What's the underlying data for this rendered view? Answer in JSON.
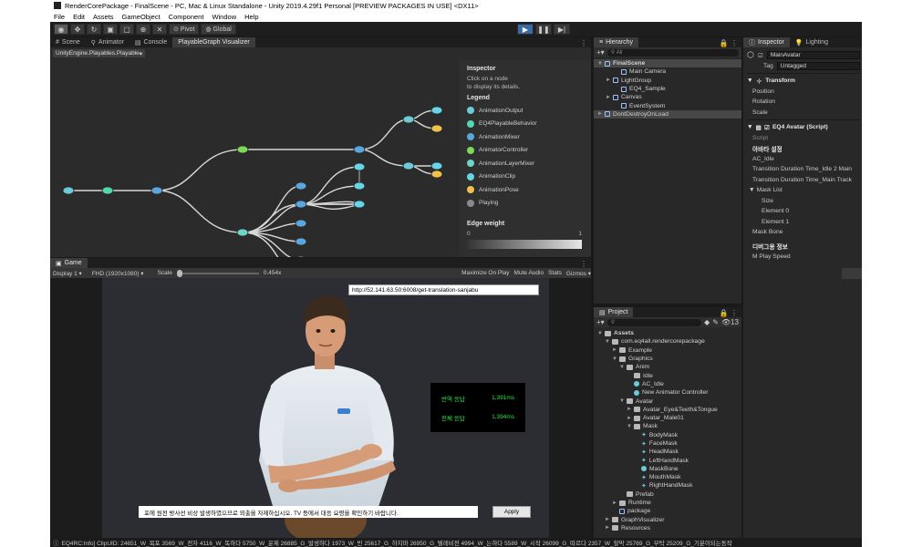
{
  "window": {
    "title": "RenderCorePackage - FinalScene - PC, Mac & Linux Standalone - Unity 2019.4.29f1 Personal [PREVIEW PACKAGES IN USE] <DX11>"
  },
  "menu": [
    "File",
    "Edit",
    "Assets",
    "GameObject",
    "Component",
    "Window",
    "Help"
  ],
  "toolbar": {
    "pivot": "Pivot",
    "global": "Global"
  },
  "scene_tabs": [
    "Scene",
    "Animator",
    "Console",
    "PlayableGraph Visualizer"
  ],
  "playable_dropdown": "UnityEngine.Playables.Playable",
  "legend_panel": {
    "inspector_title": "Inspector",
    "hint_line1": "Click on a node",
    "hint_line2": "to display its details.",
    "legend_title": "Legend",
    "items": [
      {
        "label": "AnimationOutput",
        "color": "#6ccbd8"
      },
      {
        "label": "EQ4PlayableBehavior",
        "color": "#52d8b0"
      },
      {
        "label": "AnimationMixer",
        "color": "#5aa7e0"
      },
      {
        "label": "AnimatorController",
        "color": "#7ed957"
      },
      {
        "label": "AnimationLayerMixer",
        "color": "#6ed3c8"
      },
      {
        "label": "AnimationClip",
        "color": "#66d6e6"
      },
      {
        "label": "AnimationPose",
        "color": "#f2c14b"
      },
      {
        "label": "Playing",
        "color": "#8a8a8a"
      }
    ],
    "edge_weight": "Edge weight",
    "ew_min": "0",
    "ew_max": "1"
  },
  "game": {
    "tab": "Game",
    "display": "Display 1",
    "resolution": "FHD (1920x1080)",
    "scale_label": "Scale",
    "scale_value": "0.454x",
    "maximize": "Maximize On Play",
    "mute": "Mute Audio",
    "stats": "Stats",
    "gizmos": "Gizmos",
    "url": "http://52.141.63.50:6008/get-translation-sanjabu",
    "resp1_label": "번역 응답",
    "resp1_value": "1,391ms",
    "resp2_label": "전체 응답",
    "resp2_value": "1,394ms",
    "subtitle": "포에 원전 방사선 비상 발생하였으므로 외출을 자제하십시오. TV 등에서 대응 요령을 확인하기 바랍니다.",
    "apply": "Apply"
  },
  "hierarchy": {
    "tab": "Hierarchy",
    "search": "All",
    "rows": [
      {
        "label": "FinalScene",
        "indent": 0,
        "arrow": "▼",
        "sel": true,
        "bold": true
      },
      {
        "label": "Main Camera",
        "indent": 2,
        "arrow": "",
        "sel": false
      },
      {
        "label": "LightGroup",
        "indent": 1,
        "arrow": "►",
        "sel": false
      },
      {
        "label": "EQ4_Sample",
        "indent": 2,
        "arrow": "",
        "sel": false
      },
      {
        "label": "Canvas",
        "indent": 1,
        "arrow": "►",
        "sel": false
      },
      {
        "label": "EventSystem",
        "indent": 2,
        "arrow": "",
        "sel": false
      },
      {
        "label": "DontDestroyOnLoad",
        "indent": 0,
        "arrow": "►",
        "sel": true
      }
    ]
  },
  "project": {
    "tab": "Project",
    "count": "13",
    "rows": [
      {
        "label": "Assets",
        "indent": 0,
        "arrow": "▼",
        "icon": "folder",
        "bold": true
      },
      {
        "label": "com.eq4all.rendercorepackage",
        "indent": 1,
        "arrow": "▼",
        "icon": "folder"
      },
      {
        "label": "Example",
        "indent": 2,
        "arrow": "►",
        "icon": "folder"
      },
      {
        "label": "Graphics",
        "indent": 2,
        "arrow": "▼",
        "icon": "folder"
      },
      {
        "label": "Anim",
        "indent": 3,
        "arrow": "▼",
        "icon": "folder"
      },
      {
        "label": "Idle",
        "indent": 4,
        "arrow": "",
        "icon": "folder"
      },
      {
        "label": "AC_Idle",
        "indent": 4,
        "arrow": "",
        "icon": "anim"
      },
      {
        "label": "New Animator Controller",
        "indent": 4,
        "arrow": "",
        "icon": "anim"
      },
      {
        "label": "Avatar",
        "indent": 3,
        "arrow": "▼",
        "icon": "folder"
      },
      {
        "label": "Avatar_Eye&Teeth&Tongue",
        "indent": 4,
        "arrow": "►",
        "icon": "folder"
      },
      {
        "label": "Avatar_Male01",
        "indent": 4,
        "arrow": "►",
        "icon": "folder"
      },
      {
        "label": "Mask",
        "indent": 4,
        "arrow": "▼",
        "icon": "folder"
      },
      {
        "label": "BodyMask",
        "indent": 5,
        "arrow": "",
        "icon": "mask"
      },
      {
        "label": "FaceMask",
        "indent": 5,
        "arrow": "",
        "icon": "mask"
      },
      {
        "label": "HeadMask",
        "indent": 5,
        "arrow": "",
        "icon": "mask"
      },
      {
        "label": "LeftHandMask",
        "indent": 5,
        "arrow": "",
        "icon": "mask"
      },
      {
        "label": "MaskBone",
        "indent": 5,
        "arrow": "",
        "icon": "anim"
      },
      {
        "label": "MouthMask",
        "indent": 5,
        "arrow": "",
        "icon": "mask"
      },
      {
        "label": "RightHandMask",
        "indent": 5,
        "arrow": "",
        "icon": "mask"
      },
      {
        "label": "Prefab",
        "indent": 3,
        "arrow": "",
        "icon": "folder"
      },
      {
        "label": "Runtime",
        "indent": 2,
        "arrow": "►",
        "icon": "folder"
      },
      {
        "label": "package",
        "indent": 2,
        "arrow": "",
        "icon": "go"
      },
      {
        "label": "GraphVisualizer",
        "indent": 1,
        "arrow": "►",
        "icon": "folder"
      },
      {
        "label": "Resources",
        "indent": 1,
        "arrow": "►",
        "icon": "folder"
      }
    ]
  },
  "inspector": {
    "tabs": [
      "Inspector",
      "Lighting"
    ],
    "object_name": "MainAvatar",
    "tag_label": "Tag",
    "tag_value": "Untagged",
    "transform": "Transform",
    "position": "Position",
    "rotation": "Rotation",
    "scale": "Scale",
    "script_component": "EQ4 Avatar (Script)",
    "script_label": "Script",
    "anim_settings": "아바타 설정",
    "ac_idle": "AC_Idle",
    "trans1": "Transition Duration Time_Idle 2 Main",
    "trans2": "Transition Duration Time_Main Track",
    "mask_list": "Mask List",
    "size": "Size",
    "element0": "Element 0",
    "element1": "Element 1",
    "mask_bone": "Mask Bone",
    "debug_info": "디버그용 정보",
    "m_play_speed": "M Play Speed"
  },
  "status": "EQ4RC:Info] ClipUID: 24651_W_목포 3569_W_전자 4116_W_독하다 5750_W_운제 26885_G_발생하다 1973_W_빈 25617_G_하지마 26950_G_텔레비전 4994_W_는하다 5589_W_시작 26099_G_따르다 2357_W_할막 25769_G_부탁 25209_G_기분이되는동작"
}
